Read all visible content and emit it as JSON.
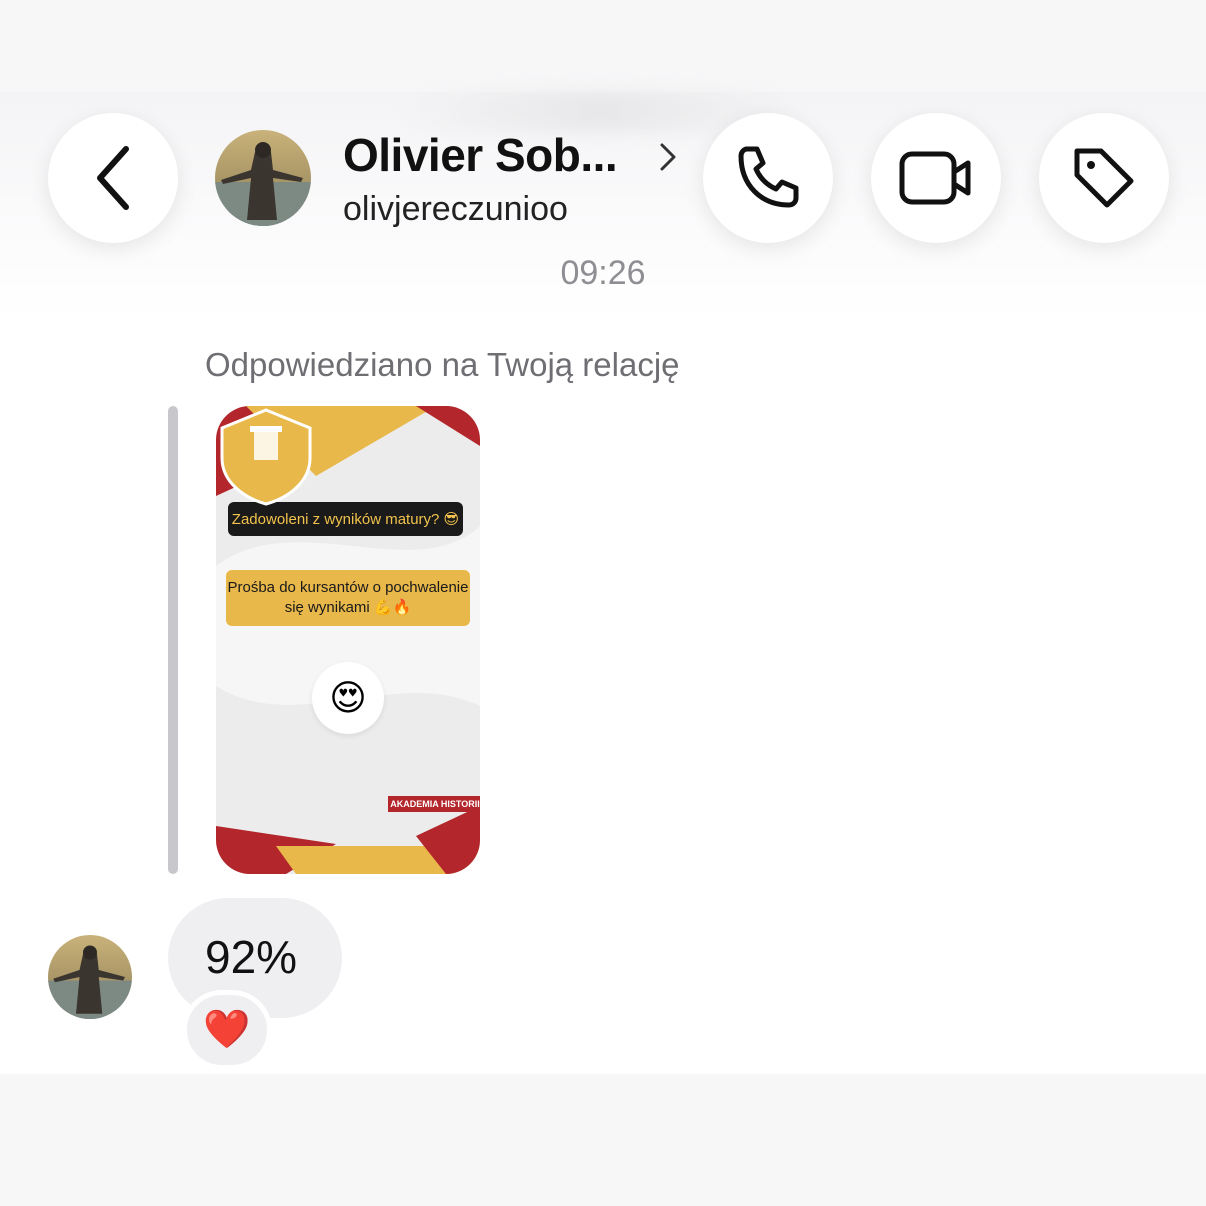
{
  "header": {
    "back_icon": "chevron-left-icon",
    "contact_name": "Olivier Sob...",
    "username": "olivjereczunioo",
    "profile_chevron_icon": "chevron-right-icon",
    "actions": [
      {
        "name": "call-button",
        "icon": "phone-icon"
      },
      {
        "name": "video-call-button",
        "icon": "video-camera-icon"
      },
      {
        "name": "tag-button",
        "icon": "tag-icon"
      }
    ]
  },
  "conversation": {
    "timestamp": "09:26",
    "story_reply_label": "Odpowiedziano na Twoją relację",
    "story": {
      "headline": "Zadowoleni z wyników matury? 😎",
      "request": "Prośba do kursantów o pochwalenie się wynikami 💪🔥",
      "reaction_emoji": "😍",
      "logo_text": "AKADEMIA HISTORII"
    },
    "message": {
      "text": "92%",
      "reaction": "❤️"
    }
  },
  "colors": {
    "story_red": "#b3262b",
    "story_gold": "#e8b84a",
    "bubble_gray": "#efeff2"
  }
}
